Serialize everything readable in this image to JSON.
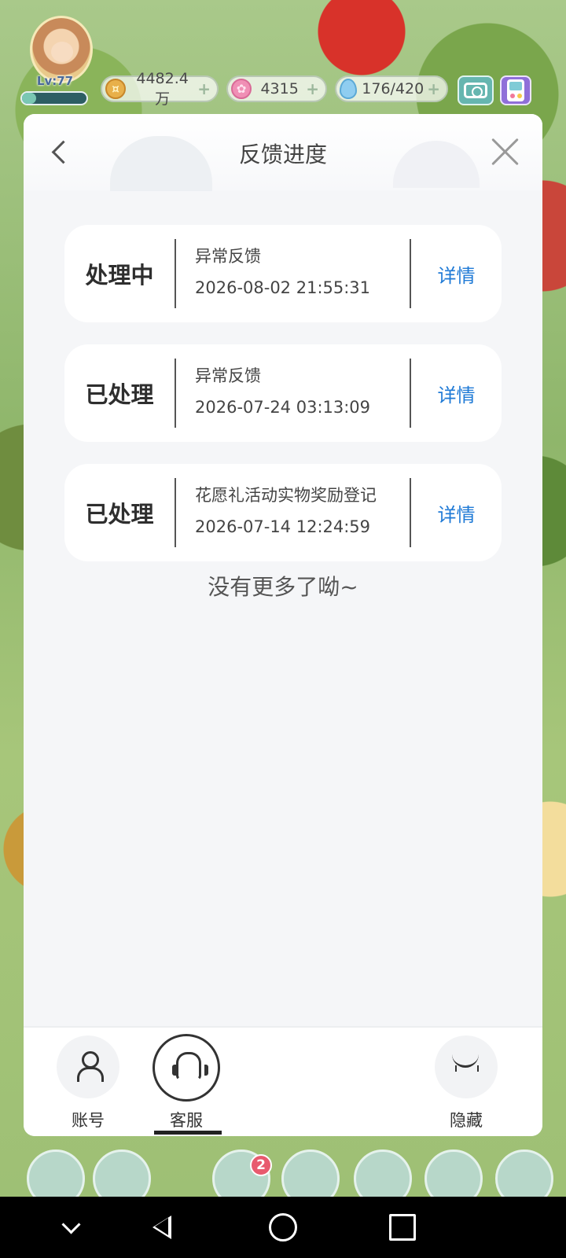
{
  "hud": {
    "level": "Lv:77",
    "exp_fraction": 0.22,
    "coins": "4482.4万",
    "flowers": "4315",
    "water": "176/420",
    "plus": "+"
  },
  "panel": {
    "title": "反馈进度",
    "records": [
      {
        "status": "处理中",
        "type": "异常反馈",
        "time": "2026-08-02 21:55:31",
        "detail": "详情"
      },
      {
        "status": "已处理",
        "type": "异常反馈",
        "time": "2026-07-24 03:13:09",
        "detail": "详情"
      },
      {
        "status": "已处理",
        "type": "花愿礼活动实物奖励登记",
        "time": "2026-07-14 12:24:59",
        "detail": "详情"
      }
    ],
    "no_more": "没有更多了呦~"
  },
  "bottom_nav": {
    "account": "账号",
    "service": "客服",
    "hide": "隐藏"
  },
  "game_bar": {
    "badge_count": "2"
  },
  "colors": {
    "accent_link": "#1f7ad6",
    "panel_bg": "#f5f6f8",
    "system_bar": "#000000"
  },
  "icons": [
    "back-arrow-icon",
    "close-icon",
    "person-icon",
    "headset-icon",
    "closed-eye-icon",
    "camera-icon",
    "game-console-icon",
    "coin-icon",
    "flower-icon",
    "water-drop-icon"
  ]
}
